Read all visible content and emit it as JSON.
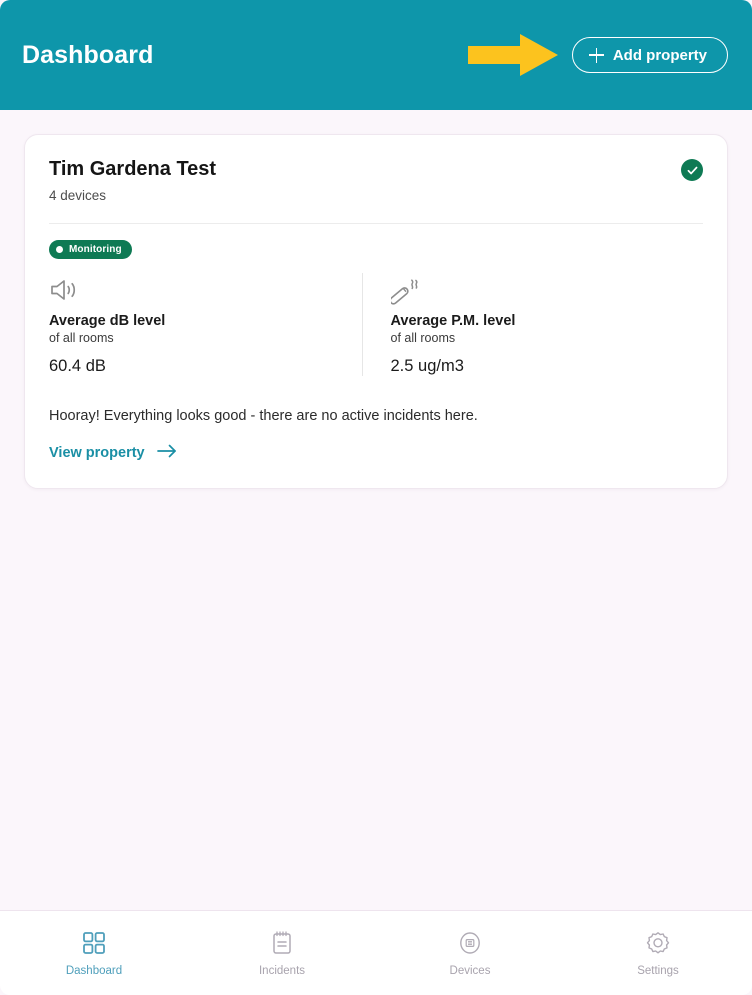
{
  "colors": {
    "header_teal": "#0e96aa",
    "page_background": "#fbf6fb",
    "accent_green": "#0e7a54",
    "link_teal": "#1a8fa5",
    "annotation_yellow": "#fcc31e",
    "nav_active": "#4f9fbb",
    "nav_inactive": "#a8a3ad"
  },
  "header": {
    "title": "Dashboard",
    "add_property_label": "Add property",
    "plus_icon": "plus-icon",
    "annotation_icon": "yellow-arrow-pointer"
  },
  "property_card": {
    "name": "Tim Gardena Test",
    "device_count": "4 devices",
    "status_icon": "check-circle-icon",
    "status_pill": {
      "label": "Monitoring",
      "dot_icon": "status-dot-icon"
    },
    "metrics": [
      {
        "icon": "speaker-volume-icon",
        "label": "Average dB level",
        "sublabel": "of all rooms",
        "value": "60.4 dB"
      },
      {
        "icon": "cigarette-smoke-icon",
        "label": "Average P.M. level",
        "sublabel": "of all rooms",
        "value": "2.5 ug/m3"
      }
    ],
    "message": "Hooray! Everything looks good - there are no active incidents here.",
    "link_label": "View property",
    "link_icon": "arrow-right-icon"
  },
  "bottom_nav": {
    "items": [
      {
        "label": "Dashboard",
        "icon": "grid-squares-icon",
        "active": true
      },
      {
        "label": "Incidents",
        "icon": "clipboard-list-icon",
        "active": false
      },
      {
        "label": "Devices",
        "icon": "sensor-circle-icon",
        "active": false
      },
      {
        "label": "Settings",
        "icon": "gear-icon",
        "active": false
      }
    ]
  }
}
